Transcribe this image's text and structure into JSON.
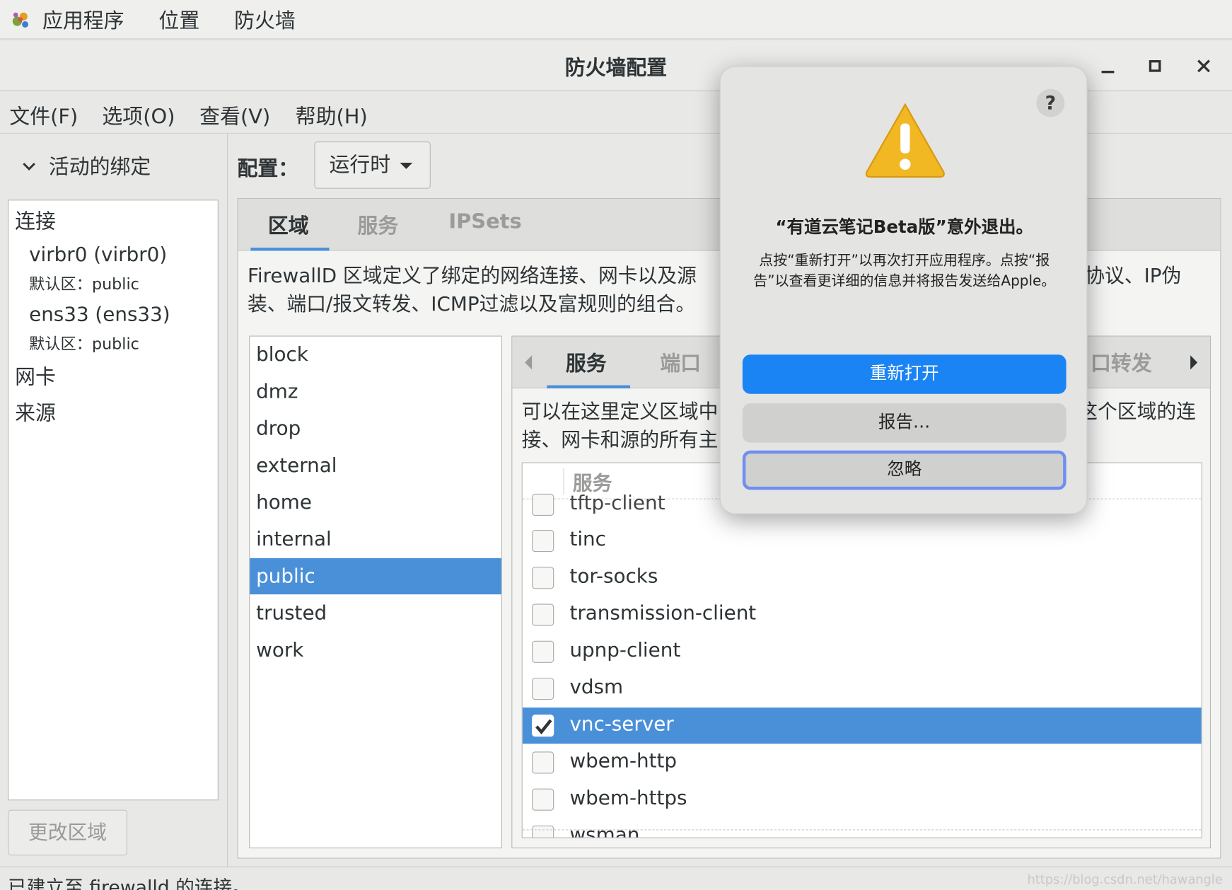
{
  "topbar": {
    "items": [
      "应用程序",
      "位置",
      "防火墙"
    ],
    "logo_icon": "gnome-foot-icon"
  },
  "window": {
    "title": "防火墙配置",
    "controls": [
      "minimize-icon",
      "maximize-icon",
      "close-icon"
    ]
  },
  "menubar": [
    "文件(F)",
    "选项(O)",
    "查看(V)",
    "帮助(H)"
  ],
  "left_pane": {
    "header": "活动的绑定",
    "sections": {
      "connections": "连接",
      "nics": "网卡",
      "sources": "来源"
    },
    "connections": [
      {
        "name": "virbr0 (virbr0)",
        "zone": "默认区：public"
      },
      {
        "name": "ens33 (ens33)",
        "zone": "默认区：public"
      }
    ],
    "change_zone_button": "更改区域"
  },
  "config": {
    "label": "配置：",
    "selected": "运行时"
  },
  "main_tabs": [
    {
      "label": "区域",
      "active": true
    },
    {
      "label": "服务",
      "active": false
    },
    {
      "label": "IPSets",
      "active": false
    }
  ],
  "zone_description": {
    "line1_left": "FirewallD 区域定义了绑定的网络连接、网卡以及源",
    "line1_right": "协议、IP伪",
    "line2": "装、端口/报文转发、ICMP过滤以及富规则的组合。"
  },
  "zones": [
    "block",
    "dmz",
    "drop",
    "external",
    "home",
    "internal",
    "public",
    "trusted",
    "work"
  ],
  "selected_zone": "public",
  "service_tabs": {
    "items": [
      {
        "label": "服务",
        "active": true
      },
      {
        "label": "端口",
        "active": false
      },
      {
        "label": "口转发",
        "active": false
      }
    ]
  },
  "service_description": {
    "line1_left": "可以在这里定义区域中",
    "line1_right": "这个区域的连",
    "line2": "接、网卡和源的所有主"
  },
  "services": {
    "header": "服务",
    "rows": [
      {
        "name": "tftp-client",
        "checked": false,
        "partial": true
      },
      {
        "name": "tinc",
        "checked": false
      },
      {
        "name": "tor-socks",
        "checked": false
      },
      {
        "name": "transmission-client",
        "checked": false
      },
      {
        "name": "upnp-client",
        "checked": false
      },
      {
        "name": "vdsm",
        "checked": false
      },
      {
        "name": "vnc-server",
        "checked": true,
        "selected": true
      },
      {
        "name": "wbem-http",
        "checked": false
      },
      {
        "name": "wbem-https",
        "checked": false
      },
      {
        "name": "wsman",
        "checked": false,
        "partial": true
      }
    ]
  },
  "statusbar": {
    "message": "已建立至 firewalld 的连接。",
    "watermark": "https://blog.csdn.net/hawangle"
  },
  "dialog": {
    "title": "“有道云笔记Beta版”意外退出。",
    "body": "点按“重新打开”以再次打开应用程序。点按“报告”以查看更详细的信息并将报告发送给Apple。",
    "reopen": "重新打开",
    "report": "报告…",
    "ignore": "忽略",
    "help": "?",
    "icon": "warning-icon"
  },
  "colors": {
    "selection": "#4a90d9",
    "dialog_primary": "#1a84f5",
    "focus_ring": "#6f8ff0",
    "warning": "#f2b824"
  }
}
